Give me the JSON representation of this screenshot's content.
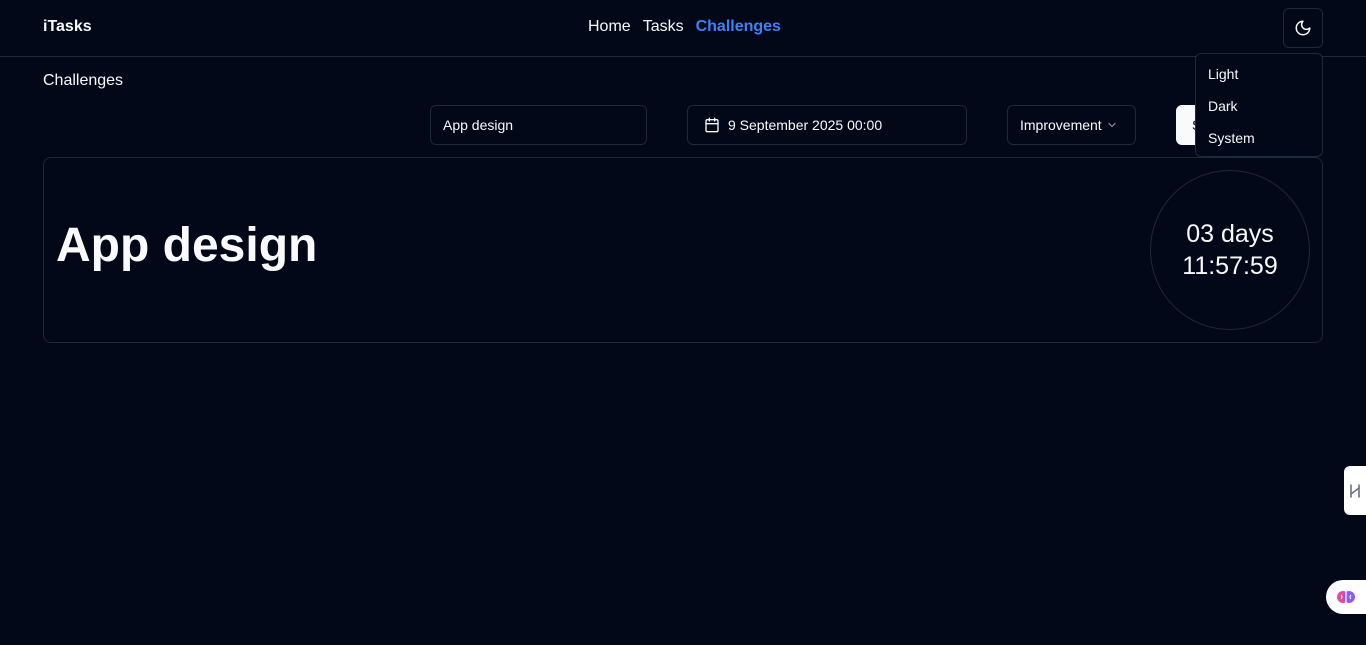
{
  "header": {
    "brand": "iTasks",
    "nav": [
      {
        "label": "Home",
        "active": false
      },
      {
        "label": "Tasks",
        "active": false
      },
      {
        "label": "Challenges",
        "active": true
      }
    ],
    "theme_toggle_icon": "moon-icon",
    "accent_color": "#3b82f6"
  },
  "page": {
    "title": "Challenges"
  },
  "form": {
    "name_value": "App design",
    "date_label": "9 September 2025 00:00",
    "category_value": "Improvement",
    "submit_label": "S"
  },
  "challenge_card": {
    "title": "App design",
    "countdown_days": "03 days",
    "countdown_time": "11:57:59"
  },
  "theme_menu": {
    "items": [
      "Light",
      "Dark",
      "System"
    ]
  },
  "colors": {
    "background": "#020817",
    "border": "#1e293b",
    "text": "#f8fafc"
  }
}
